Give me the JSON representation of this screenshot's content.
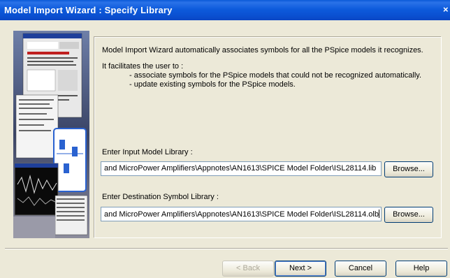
{
  "window": {
    "title": "Model Import Wizard : Specify Library",
    "close_symbol": "×"
  },
  "intro": {
    "line1": "Model Import Wizard automatically associates symbols for all the PSpice models it recognizes.",
    "line2": "It facilitates the user to :",
    "bullet1": "- associate symbols for the PSpice models that could not be recognized automatically.",
    "bullet2": "- update existing symbols for the PSpice models."
  },
  "input_library": {
    "label": "Enter Input Model Library :",
    "value": "and MicroPower Amplifiers\\Appnotes\\AN1613\\SPICE Model Folder\\ISL28114.lib",
    "browse_label": "Browse..."
  },
  "destination_library": {
    "label": "Enter Destination Symbol Library :",
    "value": "and MicroPower Amplifiers\\Appnotes\\AN1613\\SPICE Model Folder\\ISL28114.olb",
    "browse_label": "Browse..."
  },
  "buttons": {
    "back": "< Back",
    "next": "Next >",
    "cancel": "Cancel",
    "help": "Help"
  }
}
